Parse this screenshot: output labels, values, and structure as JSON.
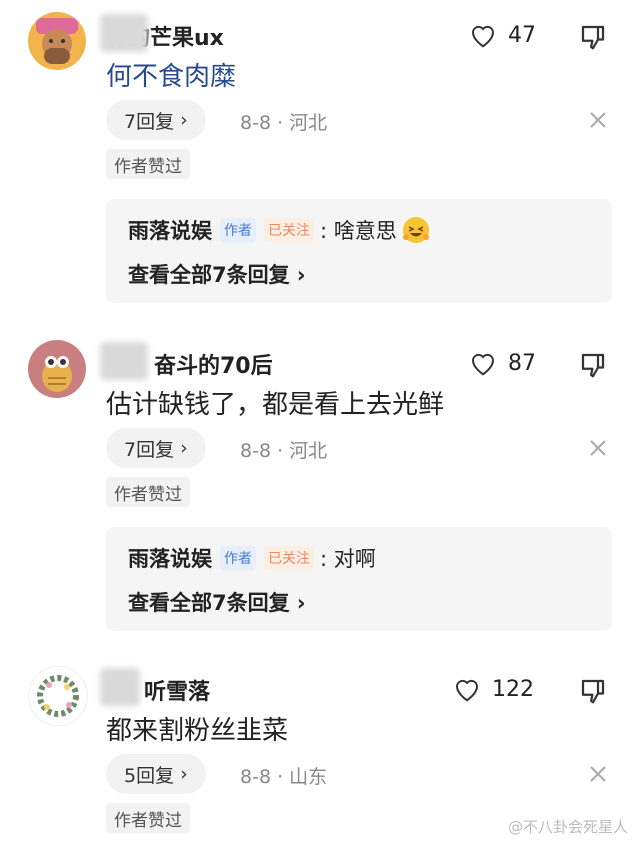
{
  "comments": [
    {
      "username": "青的芒果ux",
      "likes": "47",
      "content": "何不食肉糜",
      "reply_count": "7回复",
      "date_location": "8-8 · 河北",
      "author_tag": "作者赞过",
      "reply": {
        "author": "雨落说娱",
        "author_badge": "作者",
        "follow_badge": "已关注",
        "text": ": 啥意思",
        "view_all": "查看全部7条回复 ›"
      }
    },
    {
      "username": "奋斗的70后",
      "likes": "87",
      "content": "估计缺钱了，都是看上去光鲜",
      "reply_count": "7回复",
      "date_location": "8-8 · 河北",
      "author_tag": "作者赞过",
      "reply": {
        "author": "雨落说娱",
        "author_badge": "作者",
        "follow_badge": "已关注",
        "text": ": 对啊",
        "view_all": "查看全部7条回复 ›"
      }
    },
    {
      "username": "听雪落",
      "likes": "122",
      "content": "都来割粉丝韭菜",
      "reply_count": "5回复",
      "date_location": "8-8 · 山东",
      "author_tag": "作者赞过"
    }
  ],
  "watermark": "@不八卦会死星人",
  "colors": {
    "link": "#2a4a8f",
    "author_badge": "#4a7bd0",
    "follow_badge": "#e88a5c"
  }
}
